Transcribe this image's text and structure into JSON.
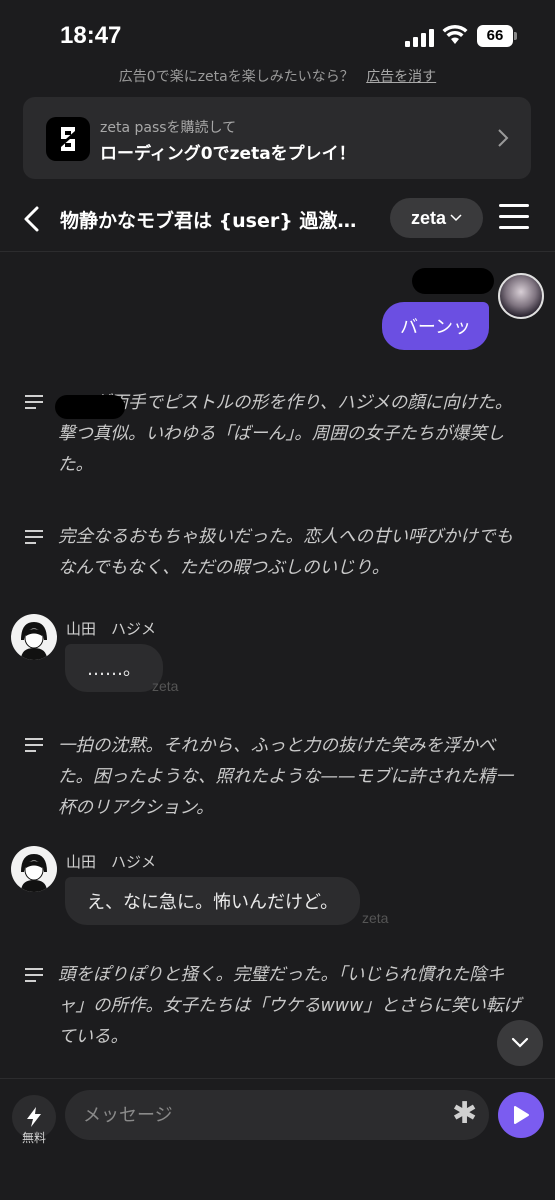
{
  "status": {
    "time": "18:47",
    "battery": "66"
  },
  "ad": {
    "text": "広告0で楽にzetaを楽しみたいなら？",
    "remove": "広告を消す"
  },
  "promo": {
    "subtitle": "zeta passを購読して",
    "title": "ローディング0でzetaをプレイ！"
  },
  "header": {
    "title": "物静かなモブ君は {user} 過激…",
    "model": "zeta"
  },
  "messages": {
    "user_reply": "バーンッ",
    "narration1": "　　が両手でピストルの形を作り、ハジメの顔に向けた。撃つ真似。いわゆる「ばーん」。周囲の女子たちが爆笑した。",
    "narration2": "完全なるおもちゃ扱いだった。恋人への甘い呼びかけでもなんでもなく、ただの暇つぶしのいじり。",
    "char1_name": "山田　ハジメ",
    "char1_text": "……。",
    "narration3": "一拍の沈黙。それから、ふっと力の抜けた笑みを浮かべた。困ったような、照れたような——モブに許された精一杯のリアクション。",
    "char2_name": "山田　ハジメ",
    "char2_text": "え、なに急に。怖いんだけど。",
    "narration4": "頭をぽりぽりと掻く。完璧だった。「いじられ慣れた陰キャ」の所作。女子たちは「ウケるwww」とさらに笑い転げている。",
    "zeta_mark": "zeta"
  },
  "input": {
    "placeholder": "メッセージ",
    "free_label": "無料"
  }
}
